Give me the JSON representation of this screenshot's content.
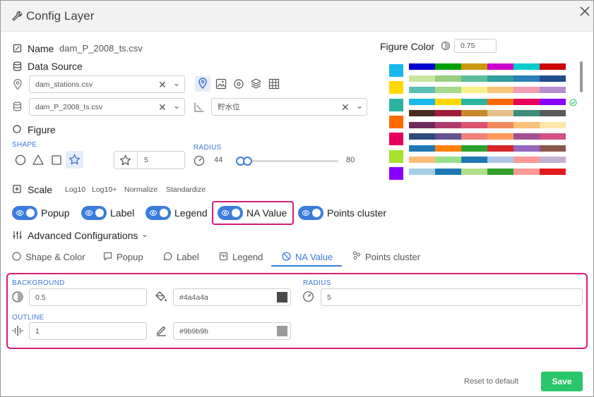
{
  "header": {
    "title": "Config Layer"
  },
  "name": {
    "label": "Name",
    "value": "dam_P_2008_ts.csv"
  },
  "data_source": {
    "label": "Data Source",
    "location_file": "dam_stations.csv",
    "data_file": "dam_P_2008_ts.csv",
    "field": "貯水位"
  },
  "figure": {
    "label": "Figure",
    "shape_label": "SHAPE",
    "size_value": "5",
    "radius_label": "RADIUS",
    "radius_min": "44",
    "radius_max": "80"
  },
  "figure_color": {
    "label": "Figure Color",
    "opacity": "0.75"
  },
  "scale": {
    "label": "Scale",
    "options": [
      "Log10",
      "Log10+",
      "Normalize",
      "Standardize"
    ]
  },
  "toggles": [
    {
      "label": "Popup",
      "on": true
    },
    {
      "label": "Label",
      "on": true
    },
    {
      "label": "Legend",
      "on": true
    },
    {
      "label": "NA Value",
      "on": true
    },
    {
      "label": "Points cluster",
      "on": true
    }
  ],
  "advanced": {
    "label": "Advanced Configurations"
  },
  "tabs": [
    "Shape & Color",
    "Popup",
    "Label",
    "Legend",
    "NA Value",
    "Points cluster"
  ],
  "active_tab": "NA Value",
  "na_panel": {
    "background_label": "BACKGROUND",
    "background_opacity": "0.5",
    "background_color": "#4a4a4a",
    "radius_label": "RADIUS",
    "radius_value": "5",
    "outline_label": "OUTLINE",
    "outline_width": "1",
    "outline_color": "#9b9b9b"
  },
  "footer": {
    "reset_label": "Reset to default",
    "save_label": "Save"
  },
  "colors": {
    "accent": "#3b7ddd",
    "highlight": "#d81b77",
    "save": "#2cc66a",
    "swatches": [
      "#1ab7ea",
      "#ffd800",
      "#2bb5a0",
      "#ff6a00",
      "#e8005a",
      "#a6e22e",
      "#8800ff"
    ],
    "palettes": [
      [
        "#0000cc",
        "#00a000",
        "#cc9900",
        "#cc00cc",
        "#00cccc",
        "#cc0000"
      ],
      [
        "#c8e6a0",
        "#9acd7e",
        "#5bbd9b",
        "#2f9e9e",
        "#2c7fb8",
        "#1f4e8c"
      ],
      [
        "#5bc0b4",
        "#a6d98c",
        "#f7f08a",
        "#f7c47a",
        "#f59bb2",
        "#b58ed0"
      ],
      [
        "#1ab7ea",
        "#ffd800",
        "#2bb5a0",
        "#ff6a00",
        "#e8005a",
        "#8800ff"
      ],
      [
        "#4a2c1f",
        "#a01c3c",
        "#c8882c",
        "#e3c08c",
        "#3d8c7c",
        "#5a5a5a"
      ],
      [
        "#6b2a5a",
        "#b03a6c",
        "#d9546a",
        "#f08a5d",
        "#f8c07a",
        "#fde6a8"
      ],
      [
        "#2f4b7c",
        "#665191",
        "#f27e7a",
        "#ff9a5a",
        "#a05195",
        "#d45087"
      ],
      [
        "#1f77b4",
        "#ff7f0e",
        "#2ca02c",
        "#d62728",
        "#9467bd",
        "#8c564b"
      ],
      [
        "#ffbb78",
        "#98df8a",
        "#1f78b4",
        "#aec7e8",
        "#ff9896",
        "#c5b0d5"
      ],
      [
        "#a6cee3",
        "#1f78b4",
        "#b2df8a",
        "#33a02c",
        "#fb9a99",
        "#e31a1c"
      ]
    ]
  }
}
